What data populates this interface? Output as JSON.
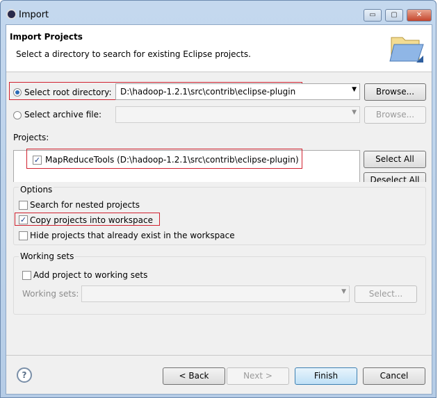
{
  "window": {
    "title": "Import",
    "minimize": "▭",
    "maximize": "▢",
    "close": "✕"
  },
  "header": {
    "title": "Import Projects",
    "description": "Select a directory to search for existing Eclipse projects.",
    "icon": "folder-open-icon"
  },
  "source": {
    "root_label": "Select root directory:",
    "root_value": "D:\\hadoop-1.2.1\\src\\contrib\\eclipse-plugin",
    "root_selected": true,
    "archive_label": "Select archive file:",
    "archive_value": "",
    "archive_selected": false,
    "browse_label": "Browse..."
  },
  "projects": {
    "label": "Projects:",
    "items": [
      {
        "label": "MapReduceTools (D:\\hadoop-1.2.1\\src\\contrib\\eclipse-plugin)",
        "checked": true
      }
    ],
    "select_all": "Select All",
    "deselect_all": "Deselect All"
  },
  "options": {
    "label": "Options",
    "items": [
      {
        "label": "Search for nested projects",
        "checked": false
      },
      {
        "label": "Copy projects into workspace",
        "checked": true
      },
      {
        "label": "Hide projects that already exist in the workspace",
        "checked": false
      }
    ]
  },
  "working_sets": {
    "label": "Working sets",
    "add_label": "Add project to working sets",
    "add_checked": false,
    "field_label": "Working sets:",
    "field_value": "",
    "select_button": "Select..."
  },
  "footer": {
    "help": "?",
    "back": "< Back",
    "next": "Next >",
    "finish": "Finish",
    "cancel": "Cancel"
  },
  "colors": {
    "highlight": "#d0202e",
    "accent": "#2a6bb5"
  }
}
